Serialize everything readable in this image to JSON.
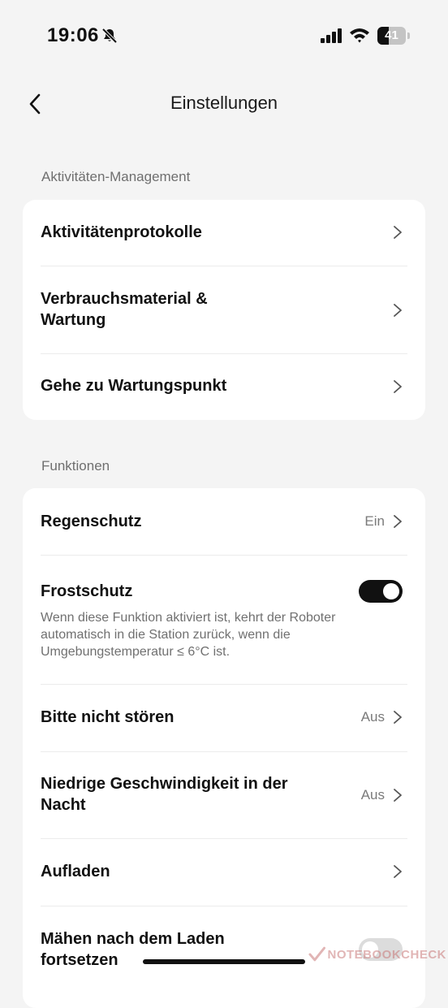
{
  "status_bar": {
    "time": "19:06",
    "battery_level": "41",
    "battery_fraction": 0.41,
    "icons": [
      "bell-slash-icon",
      "cellular-signal-icon",
      "wifi-icon",
      "battery-icon"
    ]
  },
  "header": {
    "title": "Einstellungen",
    "back_icon": "chevron-left-icon"
  },
  "sections": {
    "activities": {
      "label": "Aktivitäten-Management",
      "items": [
        {
          "label": "Aktivitätenprotokolle"
        },
        {
          "label": "Verbrauchsmaterial & Wartung"
        },
        {
          "label": "Gehe zu Wartungspunkt"
        }
      ]
    },
    "functions": {
      "label": "Funktionen",
      "items": [
        {
          "label": "Regenschutz",
          "value": "Ein"
        },
        {
          "label": "Frostschutz",
          "toggle": true,
          "description": "Wenn diese Funktion aktiviert ist, kehrt der Roboter automatisch in die Station zurück, wenn die Umgebungstemperatur ≤ 6°C ist."
        },
        {
          "label": "Bitte nicht stören",
          "value": "Aus"
        },
        {
          "label": "Niedrige Geschwindigkeit in der Nacht",
          "value": "Aus"
        },
        {
          "label": "Aufladen"
        },
        {
          "label": "Mähen nach dem Laden fortsetzen",
          "toggle": false
        }
      ]
    }
  },
  "watermark": {
    "text": "NOTEBOOKCHECK"
  },
  "colors": {
    "background": "#f4f4f4",
    "card": "#ffffff",
    "toggle_on": "#111111",
    "toggle_off": "#dcdcdc",
    "secondary_text": "#7a7a7a"
  }
}
